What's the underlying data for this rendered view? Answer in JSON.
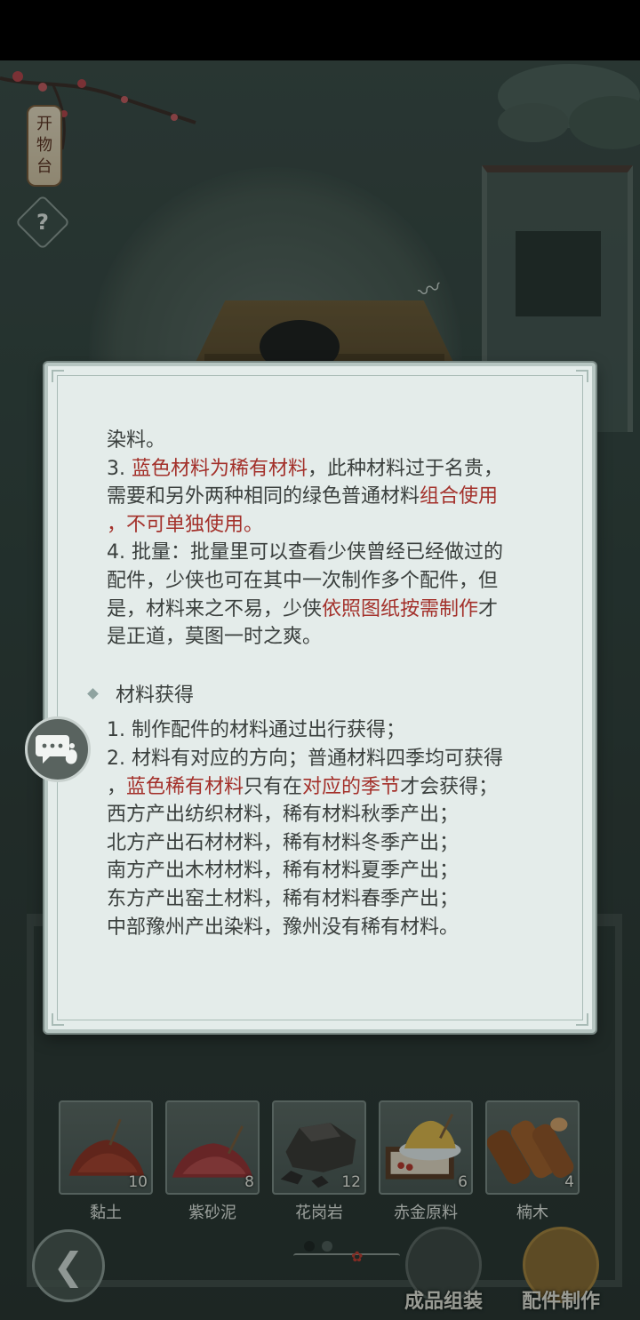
{
  "signboard": {
    "chars": [
      "开",
      "物",
      "台"
    ]
  },
  "help_button": {
    "label": "?"
  },
  "dialog": {
    "para3_line1_prefix": "3. ",
    "para3_line1_red": "蓝色材料为稀有材料",
    "para3_line1_suffix": "，此种材料过于名贵，",
    "para3_line2_prefix": "需要和另外两种相同的绿色普通材料",
    "para3_line2_red": "组合使用",
    "para3_line3_red": "，不可单独使用。",
    "lines_top": [
      "染料。"
    ],
    "para4_lines": [
      "4. 批量：批量里可以查看少侠曾经已经做过的",
      "配件，少侠也可在其中一次制作多个配件，但"
    ],
    "para4_line3_prefix": "是，材料来之不易，少侠",
    "para4_line3_red": "依照图纸按需制作",
    "para4_line3_suffix": "才",
    "para4_line4": "是正道，莫图一时之爽。",
    "section_title": "材料获得",
    "sec_line1": "1. 制作配件的材料通过出行获得；",
    "sec_line2": "2. 材料有对应的方向；普通材料四季均可获得",
    "sec_line3_prefix": "，",
    "sec_line3_red1": "蓝色稀有材料",
    "sec_line3_mid": "只有在",
    "sec_line3_red2": "对应的季节",
    "sec_line3_suffix": "才会获得；",
    "sec_lines_rest": [
      "西方产出纺织材料，稀有材料秋季产出；",
      "北方产出石材材料，稀有材料冬季产出；",
      "南方产出木材材料，稀有材料夏季产出；",
      "东方产出窑土材料，稀有材料春季产出；",
      "中部豫州产出染料，豫州没有稀有材料。"
    ]
  },
  "materials": [
    {
      "name": "黏土",
      "count": "10",
      "icon": "clay-icon"
    },
    {
      "name": "紫砂泥",
      "count": "8",
      "icon": "purple-clay-icon"
    },
    {
      "name": "花岗岩",
      "count": "12",
      "icon": "granite-icon"
    },
    {
      "name": "赤金原料",
      "count": "6",
      "icon": "gold-material-icon"
    },
    {
      "name": "楠木",
      "count": "4",
      "icon": "nanmu-wood-icon"
    }
  ],
  "pager": {
    "pages": 2,
    "current": 1
  },
  "bottom_bar": {
    "back_icon": "back-arrow-icon",
    "assemble_label": "成品组装",
    "craft_label": "配件制作"
  },
  "colors": {
    "highlight_red": "#a3302a",
    "dialog_bg": "#e4ecea"
  }
}
